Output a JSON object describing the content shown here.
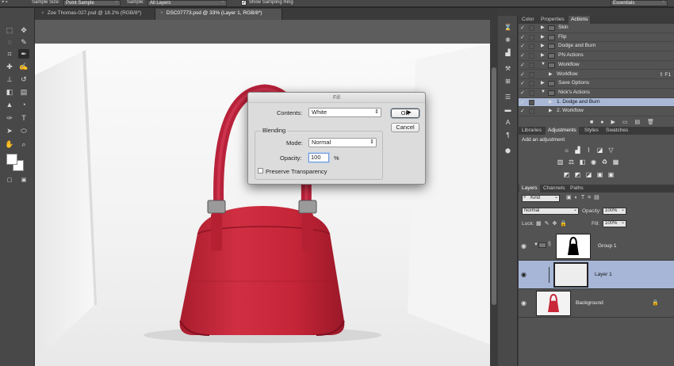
{
  "options_bar": {
    "sample_size_label": "Sample Size:",
    "sample_size_value": "Point Sample",
    "sample_label": "Sample:",
    "sample_value": "All Layers",
    "show_sampling_ring": "Show Sampling Ring",
    "workspace": "Essentials"
  },
  "doc_tabs": [
    {
      "label": "Zoe Thomas-027.psd @ 18.2% (RGB/8*)",
      "close": "×"
    },
    {
      "label": "DSC07773.psd @ 33% (Layer 1, RGB/8*)",
      "close": "×"
    }
  ],
  "fill_dialog": {
    "title": "Fill",
    "contents_label": "Contents:",
    "contents_value": "White",
    "ok_label": "OK",
    "cancel_label": "Cancel",
    "blending_label": "Blending",
    "mode_label": "Mode:",
    "mode_value": "Normal",
    "opacity_label": "Opacity:",
    "opacity_value": "100",
    "opacity_unit": "%",
    "preserve_transparency": "Preserve Transparency"
  },
  "actions_panel": {
    "tabs": [
      "Color",
      "Properties",
      "Actions"
    ],
    "active_tab": "Actions",
    "rows": [
      {
        "name": "Skin",
        "type": "set",
        "expanded": false
      },
      {
        "name": "Flip",
        "type": "set",
        "expanded": false
      },
      {
        "name": "Dodge and Burn",
        "type": "set",
        "expanded": false
      },
      {
        "name": "PN Actions",
        "type": "set",
        "expanded": false
      },
      {
        "name": "Workflow",
        "type": "set",
        "expanded": true
      },
      {
        "name": "Workflow",
        "type": "action",
        "shortcut": "⇧ F1"
      },
      {
        "name": "Save Options",
        "type": "set",
        "expanded": false
      },
      {
        "name": "Nick's Actions",
        "type": "set",
        "expanded": true
      },
      {
        "name": "1. Dodge and Burn",
        "type": "action",
        "highlight": true
      },
      {
        "name": "2. Workflow",
        "type": "action"
      }
    ]
  },
  "adjustments_panel": {
    "tabs": [
      "Libraries",
      "Adjustments",
      "Styles",
      "Swatches"
    ],
    "active_tab": "Adjustments",
    "heading": "Add an adjustment"
  },
  "layers_panel": {
    "tabs": [
      "Layers",
      "Channels",
      "Paths"
    ],
    "active_tab": "Layers",
    "filter_kind": "Kind",
    "blend_mode": "Normal",
    "opacity_label": "Opacity:",
    "opacity_value": "100%",
    "lock_label": "Lock:",
    "fill_label": "Fill:",
    "fill_value": "100%",
    "layers": [
      {
        "name": "Group 1",
        "type": "group",
        "highlight": false
      },
      {
        "name": "Layer 1",
        "type": "layer",
        "highlight": true
      },
      {
        "name": "Background",
        "type": "background",
        "highlight": false
      }
    ]
  },
  "colors": {
    "selection_blue": "#a9b8d6",
    "bag_red": "#c8283a",
    "panel_bg": "#535353"
  }
}
